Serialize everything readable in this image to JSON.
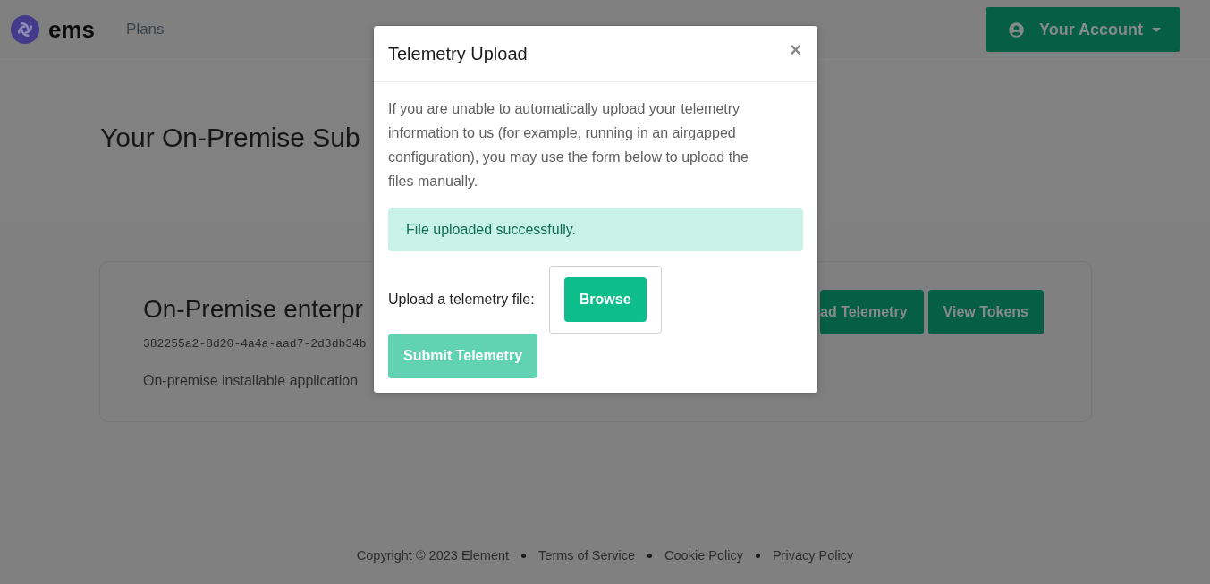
{
  "header": {
    "logo_text": "ems",
    "nav": [
      {
        "label": "Plans"
      }
    ],
    "account_button": {
      "label": "Your Account"
    }
  },
  "page": {
    "title": "Your On-Premise Sub",
    "subscription": {
      "name": "On-Premise enterpr",
      "id": "382255a2-8d20-4a4a-aad7-2d3db34b",
      "description": "On-premise installable application",
      "actions": [
        {
          "label": "ad Telemetry",
          "kind": "cut"
        },
        {
          "label": "View Tokens",
          "kind": "full"
        }
      ]
    }
  },
  "footer": {
    "copyright": "Copyright © 2023 Element",
    "links": [
      "Terms of Service",
      "Cookie Policy",
      "Privacy Policy"
    ]
  },
  "modal": {
    "title": "Telemetry Upload",
    "close_label": "×",
    "description": "If you are unable to automatically upload your telemetry information to us (for example, running in an airgapped configuration), you may use the form below to upload the files manually.",
    "alert": "File uploaded successfully.",
    "upload_label": "Upload a telemetry file:",
    "browse_button": "Browse",
    "submit_button": {
      "label": "Submit Telemetry",
      "disabled": true
    }
  }
}
